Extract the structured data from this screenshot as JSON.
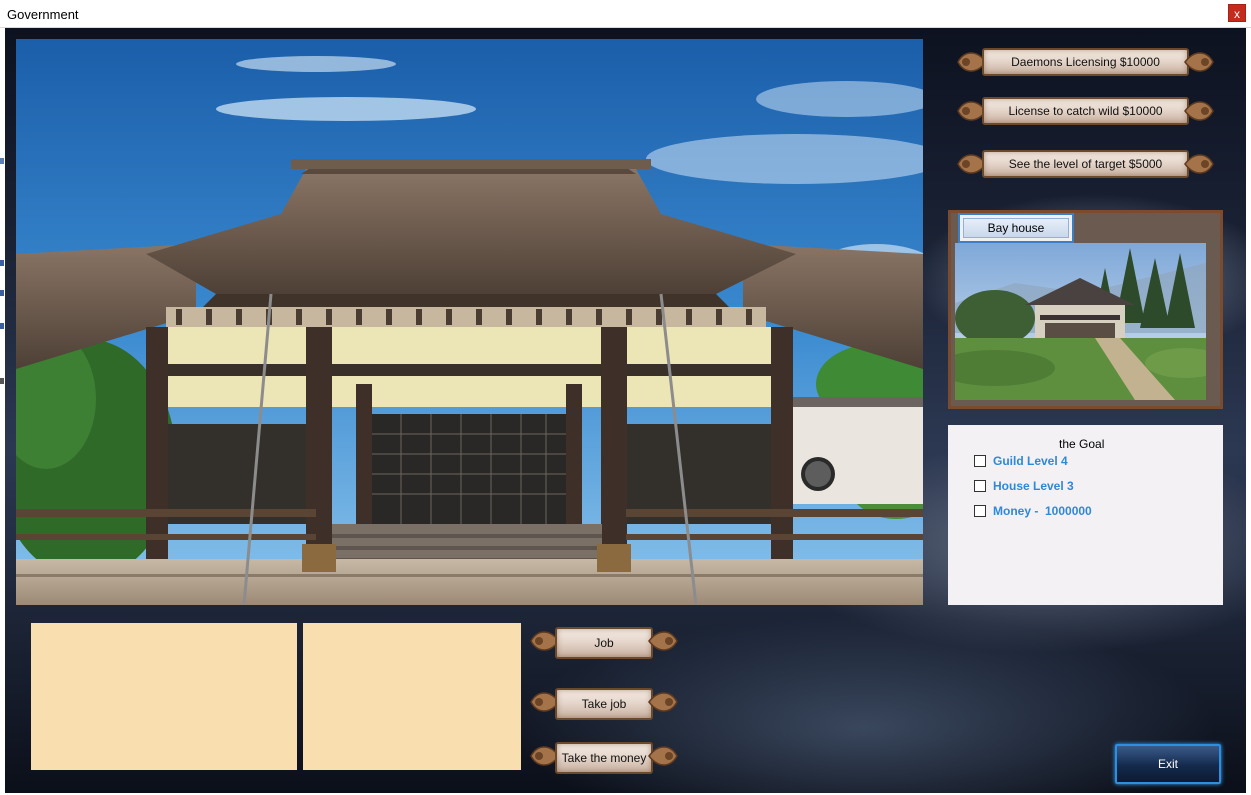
{
  "window": {
    "title": "Government",
    "close_glyph": "x"
  },
  "top_buttons": [
    {
      "label": "Daemons Licensing $10000"
    },
    {
      "label": "License to catch wild $10000"
    },
    {
      "label": "See the level of target $5000"
    }
  ],
  "property_panel": {
    "tab_label": "Bay house"
  },
  "goal": {
    "title": "the Goal",
    "items": [
      {
        "label": "Guild Level 4",
        "checked": false
      },
      {
        "label": "House Level 3",
        "checked": false
      },
      {
        "label": "Money -  1000000",
        "checked": false
      }
    ]
  },
  "job_buttons": [
    {
      "label": "Job"
    },
    {
      "label": "Take job"
    },
    {
      "label": "Take the money"
    }
  ],
  "exit_label": "Exit",
  "colors": {
    "goal_text": "#2f88d8",
    "info_box": "#f9dfb0",
    "exit_border": "#2d8fe0",
    "close_button": "#c42b1c"
  }
}
